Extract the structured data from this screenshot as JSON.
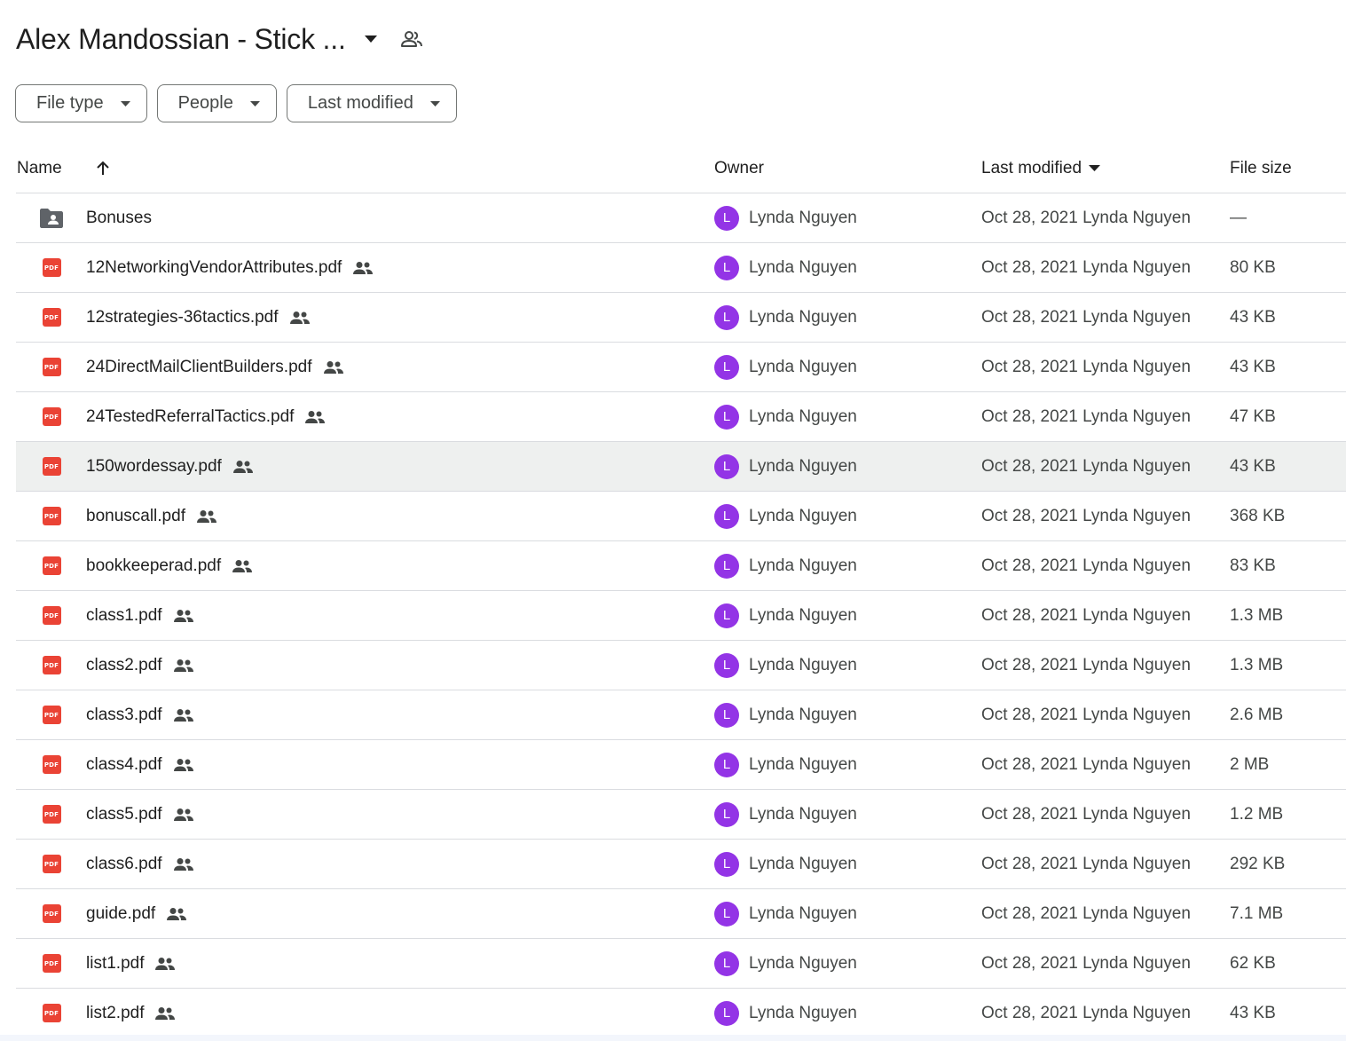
{
  "header": {
    "title": "Alex Mandossian - Stick ..."
  },
  "filters": [
    {
      "label": "File type"
    },
    {
      "label": "People"
    },
    {
      "label": "Last modified"
    }
  ],
  "columns": {
    "name": "Name",
    "owner": "Owner",
    "last_modified": "Last modified",
    "file_size": "File size"
  },
  "owner_avatar_letter": "L",
  "colors": {
    "pdf": "#ea4335",
    "avatar": "#9334e6",
    "folder": "#5f6368"
  },
  "rows": [
    {
      "type": "folder",
      "name": "Bonuses",
      "shared": false,
      "owner": "Lynda Nguyen",
      "modified": "Oct 28, 2021 Lynda Nguyen",
      "size": "—"
    },
    {
      "type": "pdf",
      "name": "12NetworkingVendorAttributes.pdf",
      "shared": true,
      "owner": "Lynda Nguyen",
      "modified": "Oct 28, 2021 Lynda Nguyen",
      "size": "80 KB"
    },
    {
      "type": "pdf",
      "name": "12strategies-36tactics.pdf",
      "shared": true,
      "owner": "Lynda Nguyen",
      "modified": "Oct 28, 2021 Lynda Nguyen",
      "size": "43 KB"
    },
    {
      "type": "pdf",
      "name": "24DirectMailClientBuilders.pdf",
      "shared": true,
      "owner": "Lynda Nguyen",
      "modified": "Oct 28, 2021 Lynda Nguyen",
      "size": "43 KB"
    },
    {
      "type": "pdf",
      "name": "24TestedReferralTactics.pdf",
      "shared": true,
      "owner": "Lynda Nguyen",
      "modified": "Oct 28, 2021 Lynda Nguyen",
      "size": "47 KB"
    },
    {
      "type": "pdf",
      "name": "150wordessay.pdf",
      "shared": true,
      "owner": "Lynda Nguyen",
      "modified": "Oct 28, 2021 Lynda Nguyen",
      "size": "43 KB",
      "selected": true
    },
    {
      "type": "pdf",
      "name": "bonuscall.pdf",
      "shared": true,
      "owner": "Lynda Nguyen",
      "modified": "Oct 28, 2021 Lynda Nguyen",
      "size": "368 KB"
    },
    {
      "type": "pdf",
      "name": "bookkeeperad.pdf",
      "shared": true,
      "owner": "Lynda Nguyen",
      "modified": "Oct 28, 2021 Lynda Nguyen",
      "size": "83 KB"
    },
    {
      "type": "pdf",
      "name": "class1.pdf",
      "shared": true,
      "owner": "Lynda Nguyen",
      "modified": "Oct 28, 2021 Lynda Nguyen",
      "size": "1.3 MB"
    },
    {
      "type": "pdf",
      "name": "class2.pdf",
      "shared": true,
      "owner": "Lynda Nguyen",
      "modified": "Oct 28, 2021 Lynda Nguyen",
      "size": "1.3 MB"
    },
    {
      "type": "pdf",
      "name": "class3.pdf",
      "shared": true,
      "owner": "Lynda Nguyen",
      "modified": "Oct 28, 2021 Lynda Nguyen",
      "size": "2.6 MB"
    },
    {
      "type": "pdf",
      "name": "class4.pdf",
      "shared": true,
      "owner": "Lynda Nguyen",
      "modified": "Oct 28, 2021 Lynda Nguyen",
      "size": "2 MB"
    },
    {
      "type": "pdf",
      "name": "class5.pdf",
      "shared": true,
      "owner": "Lynda Nguyen",
      "modified": "Oct 28, 2021 Lynda Nguyen",
      "size": "1.2 MB"
    },
    {
      "type": "pdf",
      "name": "class6.pdf",
      "shared": true,
      "owner": "Lynda Nguyen",
      "modified": "Oct 28, 2021 Lynda Nguyen",
      "size": "292 KB"
    },
    {
      "type": "pdf",
      "name": "guide.pdf",
      "shared": true,
      "owner": "Lynda Nguyen",
      "modified": "Oct 28, 2021 Lynda Nguyen",
      "size": "7.1 MB"
    },
    {
      "type": "pdf",
      "name": "list1.pdf",
      "shared": true,
      "owner": "Lynda Nguyen",
      "modified": "Oct 28, 2021 Lynda Nguyen",
      "size": "62 KB"
    },
    {
      "type": "pdf",
      "name": "list2.pdf",
      "shared": true,
      "owner": "Lynda Nguyen",
      "modified": "Oct 28, 2021 Lynda Nguyen",
      "size": "43 KB"
    }
  ]
}
